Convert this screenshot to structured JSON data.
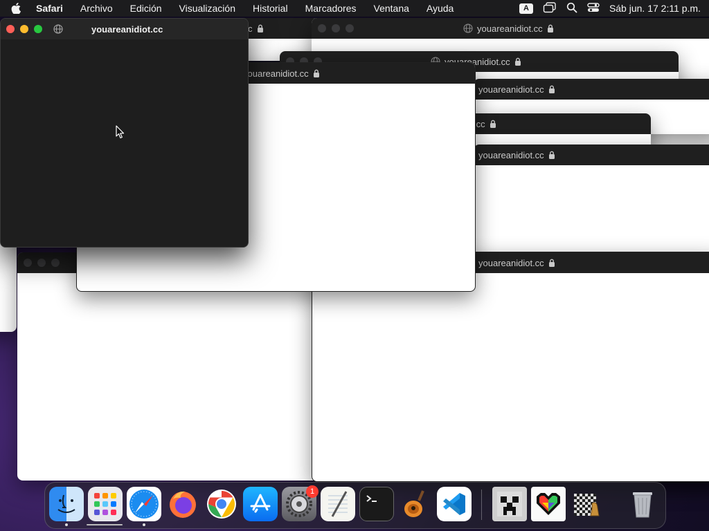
{
  "menubar": {
    "apple_icon": "apple-logo-icon",
    "app_name": "Safari",
    "menus": [
      "Archivo",
      "Edición",
      "Visualización",
      "Historial",
      "Marcadores",
      "Ventana",
      "Ayuda"
    ],
    "input_badge": "A",
    "datetime": "Sáb jun. 17  2:11 p.m."
  },
  "windows": {
    "front_title": "youareanidiot.cc",
    "url": "youareanidiot.cc",
    "url_partial_ccc": "youareanidiot.cc",
    "url_partial_cc": ".cc",
    "url_partial_c": "c"
  },
  "dock": {
    "apps": [
      "Finder",
      "Launchpad",
      "Safari",
      "Firefox",
      "Chrome",
      "App Store",
      "System Settings",
      "TextEdit",
      "Terminal",
      "GarageBand",
      "Visual Studio Code",
      "Minecraft",
      "Pixel Heart",
      "Chess",
      "Trash"
    ],
    "settings_badge": "1"
  },
  "colors": {
    "menubar_bg": "#1c1c1e",
    "titlebar_bg": "#1f1f1f",
    "window_bg": "#ffffff",
    "front_window_bg": "#1e1e1e",
    "close": "#ff5f57",
    "minimize": "#febc2e",
    "zoom": "#28c840",
    "badge": "#ff3b30"
  }
}
